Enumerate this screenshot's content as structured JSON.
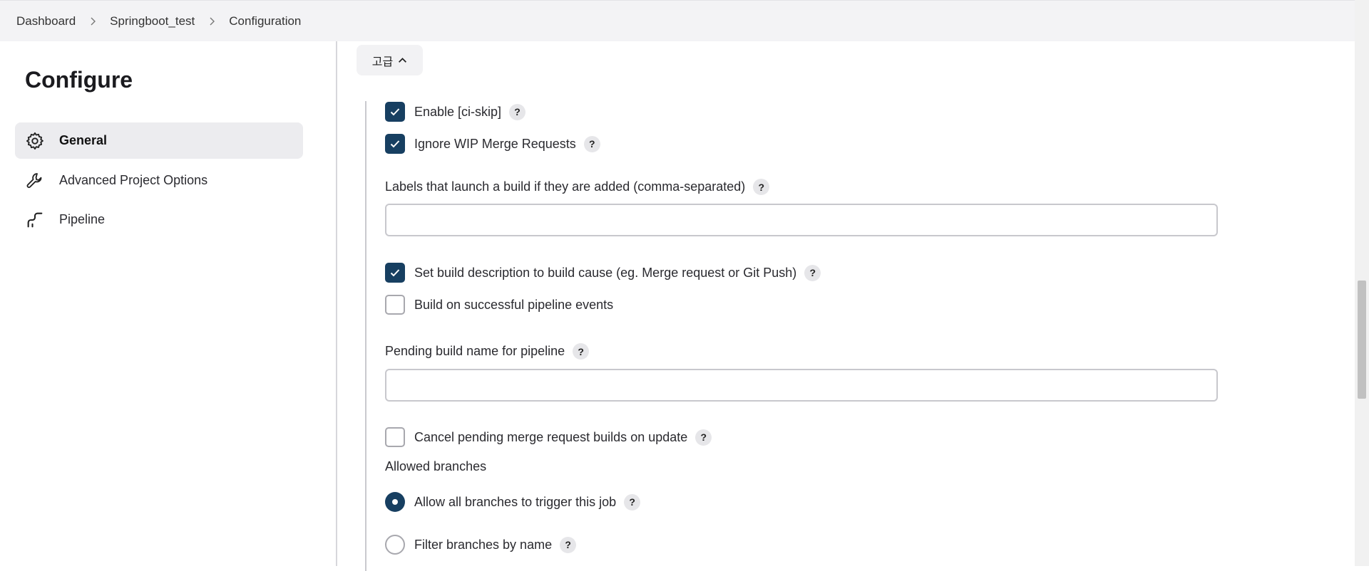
{
  "breadcrumb": [
    "Dashboard",
    "Springboot_test",
    "Configuration"
  ],
  "sidebar": {
    "title": "Configure",
    "items": [
      {
        "label": "General",
        "icon": "gear-icon",
        "active": true
      },
      {
        "label": "Advanced Project Options",
        "icon": "wrench-icon",
        "active": false
      },
      {
        "label": "Pipeline",
        "icon": "pipeline-icon",
        "active": false
      }
    ]
  },
  "main": {
    "advanced_button": "고급",
    "enable_ci_skip": {
      "label": "Enable [ci-skip]",
      "checked": true
    },
    "ignore_wip": {
      "label": "Ignore WIP Merge Requests",
      "checked": true
    },
    "labels_field": {
      "label": "Labels that launch a build if they are added (comma-separated)",
      "value": ""
    },
    "set_build_description": {
      "label": "Set build description to build cause (eg. Merge request or Git Push)",
      "checked": true
    },
    "build_on_pipeline": {
      "label": "Build on successful pipeline events",
      "checked": false
    },
    "pending_build_name": {
      "label": "Pending build name for pipeline",
      "value": ""
    },
    "cancel_pending": {
      "label": "Cancel pending merge request builds on update",
      "checked": false
    },
    "allowed_branches": {
      "label": "Allowed branches",
      "options": [
        {
          "label": "Allow all branches to trigger this job",
          "selected": true
        },
        {
          "label": "Filter branches by name",
          "selected": false
        }
      ]
    },
    "help_symbol": "?"
  },
  "colors": {
    "accent": "#173f61",
    "breadcrumb_bg": "#f3f3f5",
    "active_item_bg": "#ececef"
  }
}
